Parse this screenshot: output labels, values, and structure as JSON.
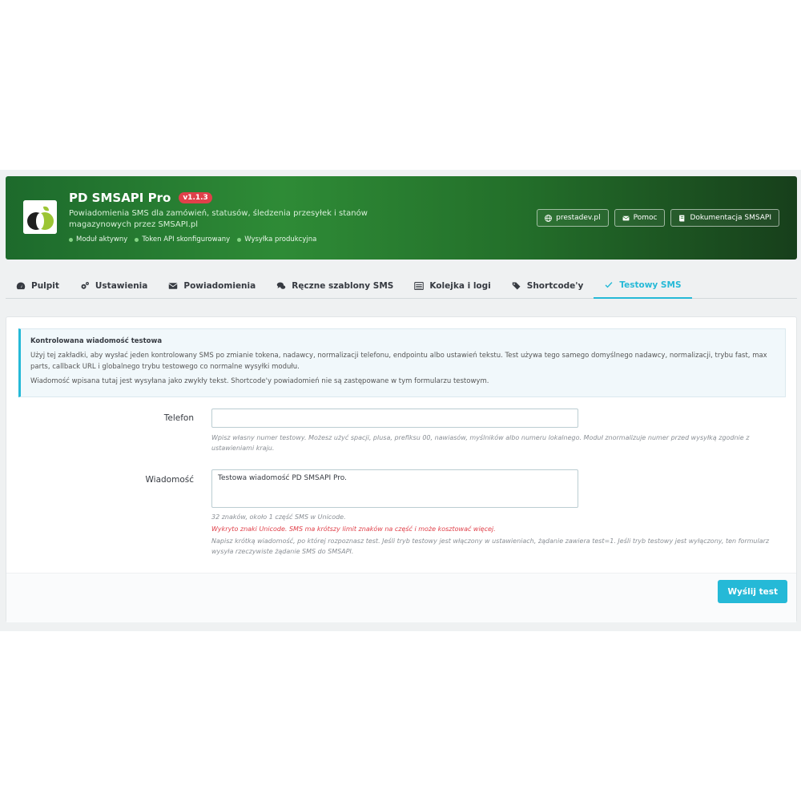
{
  "header": {
    "title": "PD SMSAPI Pro",
    "version": "v1.1.3",
    "subtitle": "Powiadomienia SMS dla zamówień, statusów, śledzenia przesyłek i stanów magazynowych przez SMSAPI.pl",
    "statuses": [
      "Moduł aktywny",
      "Token API skonfigurowany",
      "Wysyłka produkcyjna"
    ],
    "status_color": "#84d484",
    "links": {
      "website": "prestadev.pl",
      "help": "Pomoc",
      "docs": "Dokumentacja SMSAPI"
    }
  },
  "tabs": [
    {
      "label": "Pulpit",
      "icon": "dashboard-icon"
    },
    {
      "label": "Ustawienia",
      "icon": "cogs-icon"
    },
    {
      "label": "Powiadomienia",
      "icon": "envelope-icon"
    },
    {
      "label": "Ręczne szablony SMS",
      "icon": "comments-icon"
    },
    {
      "label": "Kolejka i logi",
      "icon": "list-icon"
    },
    {
      "label": "Shortcode'y",
      "icon": "tags-icon"
    },
    {
      "label": "Testowy SMS",
      "icon": "check-icon",
      "active": true
    }
  ],
  "alert": {
    "title": "Kontrolowana wiadomość testowa",
    "text1": "Użyj tej zakładki, aby wysłać jeden kontrolowany SMS po zmianie tokena, nadawcy, normalizacji telefonu, endpointu albo ustawień tekstu. Test używa tego samego domyślnego nadawcy, normalizacji, trybu fast, max parts, callback URL i globalnego trybu testowego co normalne wysyłki modułu.",
    "text2": "Wiadomość wpisana tutaj jest wysyłana jako zwykły tekst. Shortcode'y powiadomień nie są zastępowane w tym formularzu testowym."
  },
  "form": {
    "phone": {
      "label": "Telefon",
      "value": "",
      "help": "Wpisz własny numer testowy. Możesz użyć spacji, plusa, prefiksu 00, nawiasów, myślników albo numeru lokalnego. Moduł znormalizuje numer przed wysyłką zgodnie z ustawieniami kraju."
    },
    "message": {
      "label": "Wiadomość",
      "value": "Testowa wiadomość PD SMSAPI Pro.",
      "counter": "32 znaków, około 1 część SMS w Unicode.",
      "warning": "Wykryto znaki Unicode. SMS ma krótszy limit znaków na część i może kosztować więcej.",
      "help": "Napisz krótką wiadomość, po której rozpoznasz test. Jeśli tryb testowy jest włączony w ustawieniach, żądanie zawiera test=1. Jeśli tryb testowy jest wyłączony, ten formularz wysyła rzeczywiste żądanie SMS do SMSAPI."
    },
    "submit_label": "Wyślij test"
  },
  "colors": {
    "accent": "#25b9d7",
    "banner_green": "#2e8b36",
    "version_badge": "#e0404a",
    "warning_text": "#e0404a"
  }
}
